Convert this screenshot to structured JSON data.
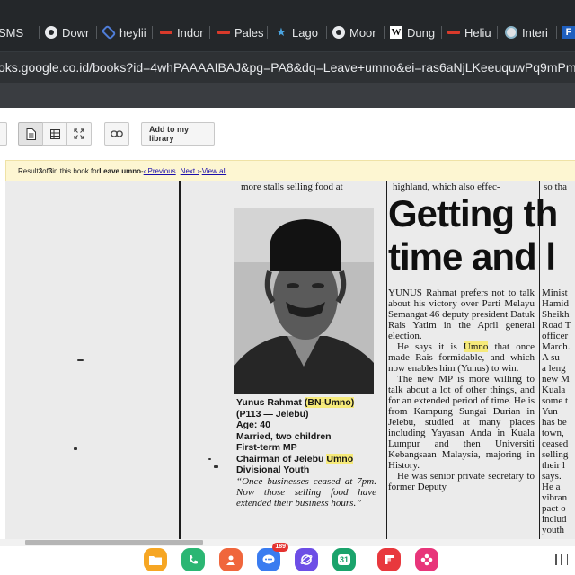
{
  "browser": {
    "tabs": [
      {
        "label": "SMS",
        "icon": "sms-icon"
      },
      {
        "label": "Dowr",
        "icon": "chrome-icon"
      },
      {
        "label": "heylii",
        "icon": "heylink-icon"
      },
      {
        "label": "Indor",
        "icon": "news-icon"
      },
      {
        "label": "Pales",
        "icon": "news-icon"
      },
      {
        "label": "Lago",
        "icon": "runner-icon"
      },
      {
        "label": "Moor",
        "icon": "chrome-icon"
      },
      {
        "label": "Dung",
        "icon": "wikipedia-icon"
      },
      {
        "label": "Heliu",
        "icon": "news-icon"
      },
      {
        "label": "Interi",
        "icon": "globe-icon"
      },
      {
        "label": "F",
        "icon": "f-icon"
      }
    ],
    "url": "oks.google.co.id/books?id=4whPAAAAIBAJ&pg=PA8&dq=Leave+umno&ei=ras6aNjLKeeuquwPq9mPm"
  },
  "toolbar": {
    "add_library_label": "Add to my library"
  },
  "result_banner": {
    "prefix": "Result ",
    "current": "3",
    "of_text": " of ",
    "total": "3",
    "middle": " in this book for ",
    "query": "Leave umno",
    "dash": " - ",
    "previous": "‹ Previous",
    "next": "Next ›",
    "dash2": " - ",
    "view_all": "View all"
  },
  "article": {
    "left_top_line": "more stalls selling food at",
    "mid_top_line": "highland, which also effec-",
    "right_top_line": "so tha",
    "headline_line1": "Getting th",
    "headline_line2": "time and l",
    "caption": {
      "name": "Yunus Rahmat",
      "party": "(BN-Umno)",
      "seat": "(P113 — Jelebu)",
      "age": "Age: 40",
      "family": "Married, two children",
      "term": "First-term MP",
      "role_a": "Chairman of Jelebu",
      "role_b": "Umno",
      "role_c": "Divisional Youth",
      "quote": "“Once businesses ceased at 7pm. Now those selling food have extended their business hours.”"
    },
    "body": {
      "p1": "YUNUS Rahmat prefers not to talk about his victory over Parti Melayu Semangat 46 deputy president Datuk Rais Yatim in the April general election.",
      "p2a": "He says it is ",
      "p2b": "Umno",
      "p2c": " that once made Rais formidable, and which now enables him (Yunus) to win.",
      "p3": "The new MP is more willing to talk about a lot of other things, and for an extended period of time. He is from Kampung Sungai Durian in Jelebu, studied at many places including Yayasan Anda in Kuala Lumpur and then Universiti Kebangsaan Malaysia, majoring in History.",
      "p4": "He was senior private secretary to former Deputy"
    },
    "right_fragments": [
      "Minist",
      "Hamid",
      "Sheikh",
      "Road T",
      "officer",
      "March.",
      "A su",
      "a leng",
      "new M",
      "Kuala",
      "some t",
      "Yun",
      "has be",
      "town,",
      "ceased",
      "selling",
      "their l",
      "says.",
      "He a",
      "vibran",
      "pact o",
      "includ",
      "youth"
    ]
  },
  "dock": {
    "messages_badge": "189",
    "calendar_day": "31"
  }
}
